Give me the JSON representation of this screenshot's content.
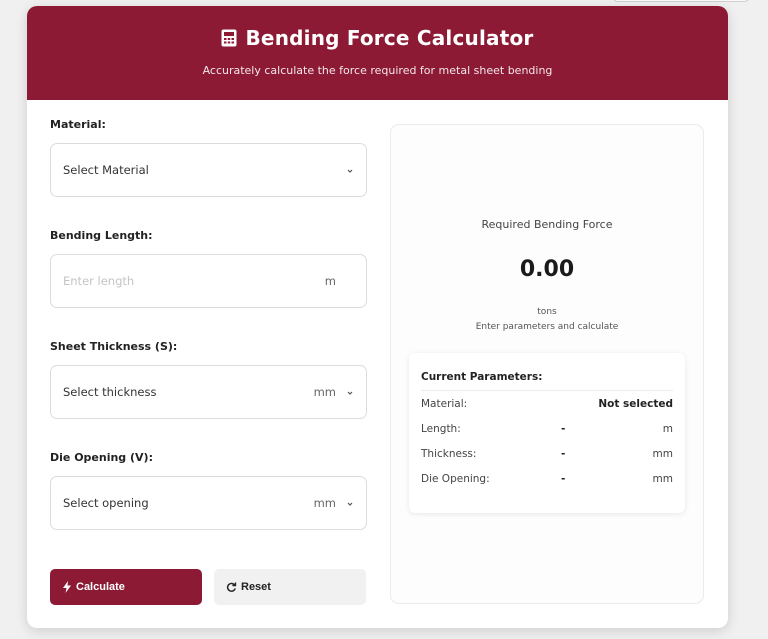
{
  "header": {
    "title": "Bending Force Calculator",
    "subtitle": "Accurately calculate the force required for metal sheet bending",
    "color": "#8d1a34"
  },
  "form": {
    "material": {
      "label": "Material:",
      "value": "Select Material"
    },
    "length": {
      "label": "Bending Length:",
      "placeholder": "Enter length",
      "unit": "m"
    },
    "thickness": {
      "label": "Sheet Thickness (S):",
      "value": "Select thickness",
      "unit": "mm"
    },
    "opening": {
      "label": "Die Opening (V):",
      "value": "Select opening",
      "unit": "mm"
    }
  },
  "buttons": {
    "calculate": "Calculate",
    "reset": "Reset"
  },
  "result": {
    "label": "Required Bending Force",
    "value": "0.00",
    "unit": "tons",
    "hint": "Enter parameters and calculate"
  },
  "params": {
    "title": "Current Parameters:",
    "rows": [
      {
        "label": "Material:",
        "dash": "",
        "value": "Not selected"
      },
      {
        "label": "Length:",
        "dash": "-",
        "value": "m"
      },
      {
        "label": "Thickness:",
        "dash": "-",
        "value": "mm"
      },
      {
        "label": "Die Opening:",
        "dash": "-",
        "value": "mm"
      }
    ]
  }
}
